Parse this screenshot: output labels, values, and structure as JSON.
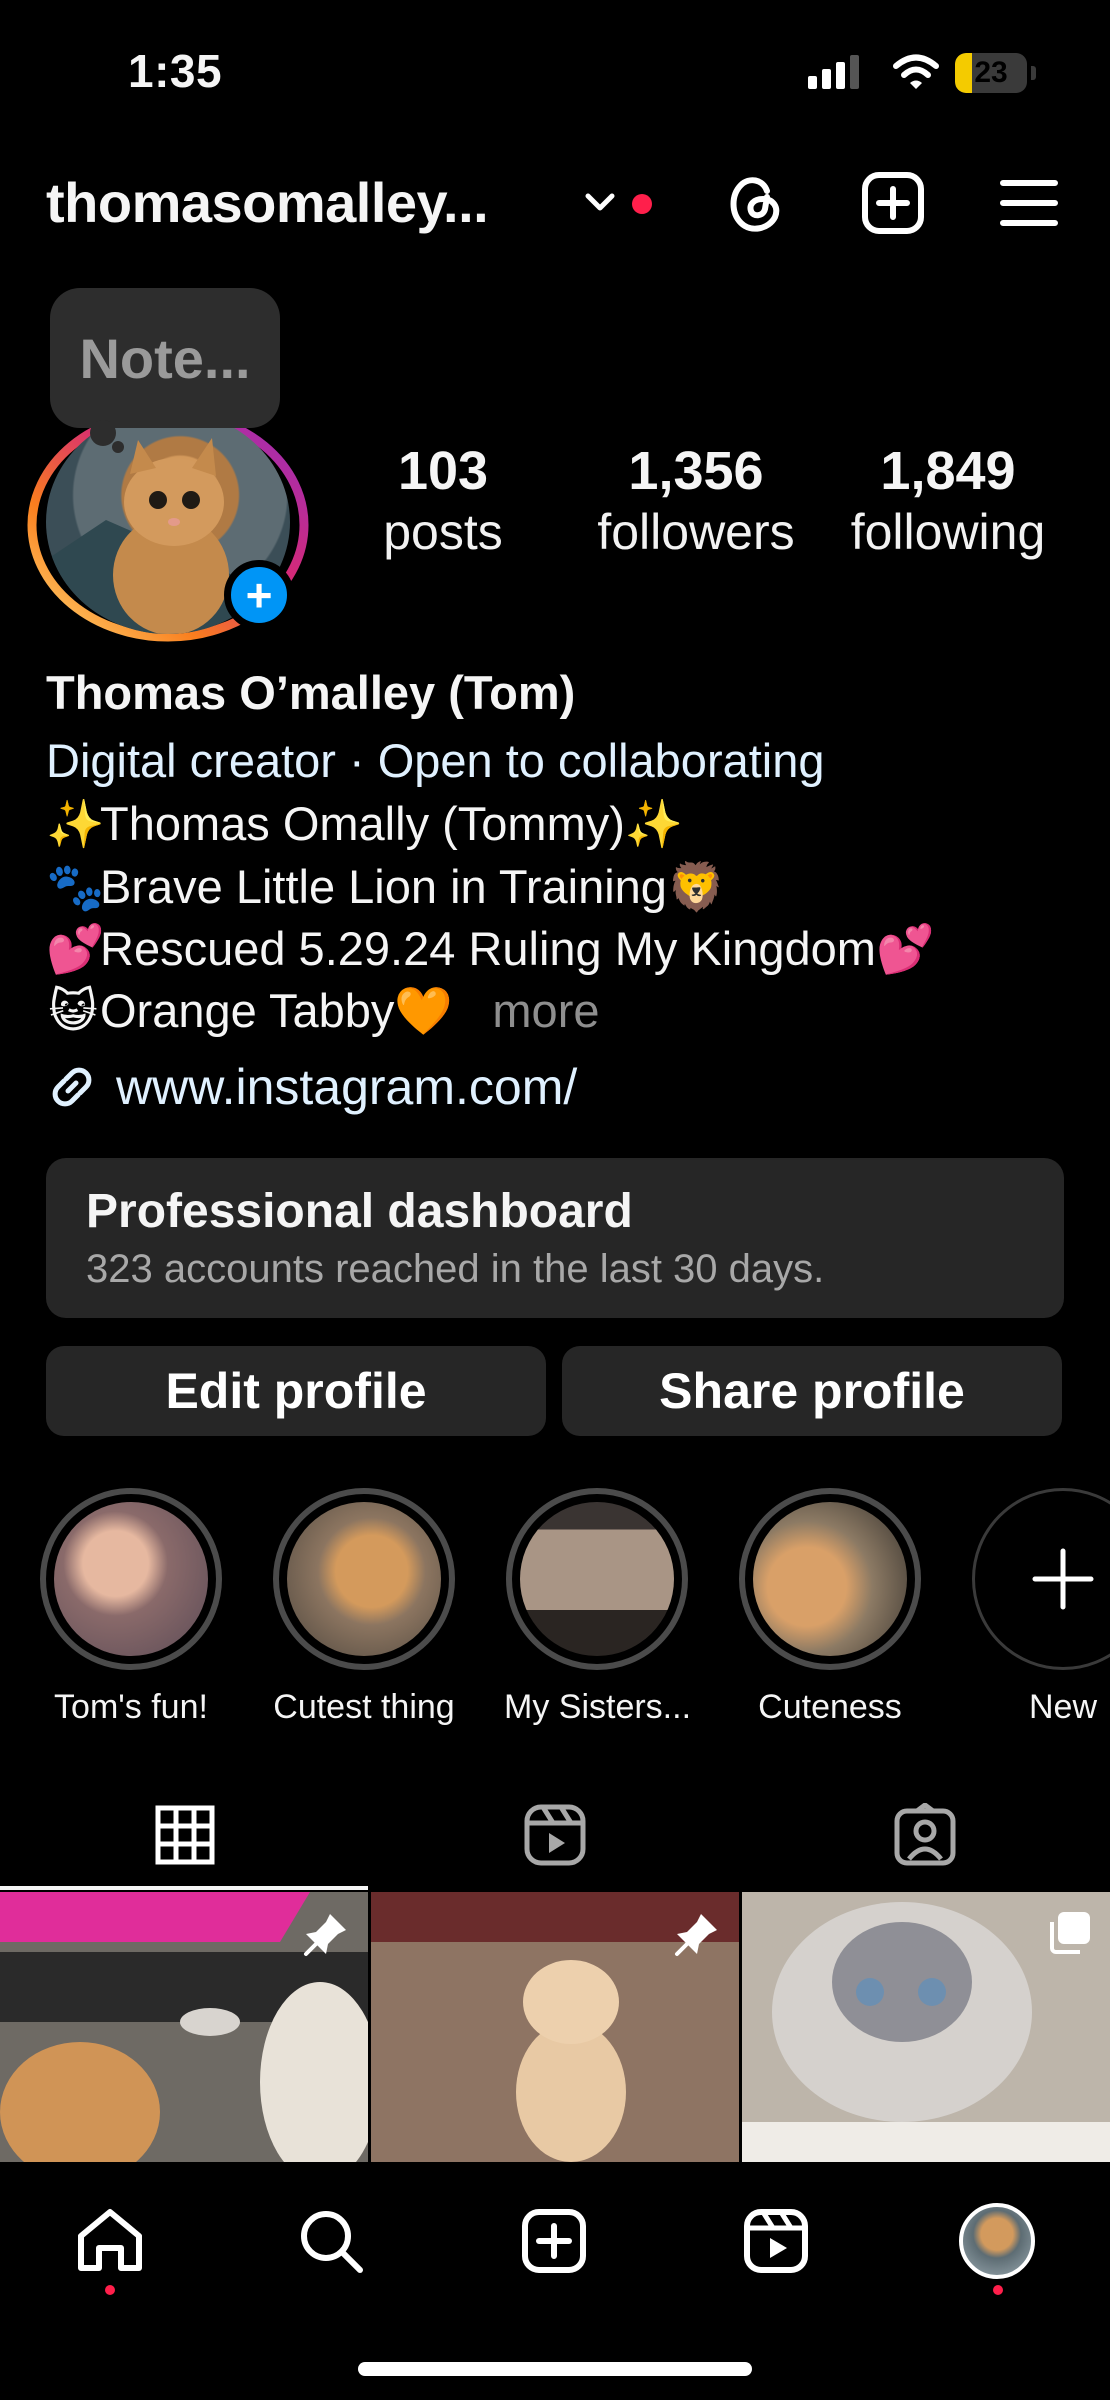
{
  "status_bar": {
    "time": "1:35",
    "battery": "23",
    "battery_level": 0.23,
    "signal_bars": 3
  },
  "header": {
    "username": "thomasomalley...",
    "icons": [
      "chevron-down-icon",
      "threads-icon",
      "create-icon",
      "menu-icon"
    ]
  },
  "note": {
    "placeholder": "Note..."
  },
  "stats": [
    {
      "value": "103",
      "label": "posts"
    },
    {
      "value": "1,356",
      "label": "followers"
    },
    {
      "value": "1,849",
      "label": "following"
    }
  ],
  "bio": {
    "name": "Thomas O’malley (Tom)",
    "category": "Digital creator · Open to collaborating",
    "lines": [
      {
        "emoji_start": "✨",
        "text": "Thomas Omally (Tommy)",
        "emoji_end": "✨"
      },
      {
        "emoji_start": "🐾",
        "text": "Brave Little Lion in Training",
        "emoji_end": "🦁"
      },
      {
        "emoji_start": "💕",
        "text": "Rescued 5.29.24 Ruling My Kingdom",
        "emoji_end": "💕"
      },
      {
        "emoji_start": "😺",
        "text": "Orange Tabby",
        "emoji_end": "🧡"
      }
    ],
    "more": "more",
    "link": "www.instagram.com/"
  },
  "dashboard": {
    "title": "Professional dashboard",
    "subtitle": "323 accounts reached in the last 30 days."
  },
  "buttons": {
    "edit": "Edit profile",
    "share": "Share profile"
  },
  "highlights": [
    {
      "label": "Tom's fun!"
    },
    {
      "label": "Cutest thing"
    },
    {
      "label": "My Sisters..."
    },
    {
      "label": "Cuteness"
    },
    {
      "label": "New"
    }
  ],
  "tabs": [
    "grid-icon",
    "reels-icon",
    "tagged-icon"
  ],
  "posts": [
    {
      "name": "post-kittens-pinned",
      "badge": "pin-icon"
    },
    {
      "name": "post-kitten-floor-pinned",
      "badge": "pin-icon"
    },
    {
      "name": "post-siamese-cat",
      "badge": "carousel-icon"
    }
  ],
  "nav": [
    "home-icon",
    "search-icon",
    "create-icon",
    "reels-icon",
    "profile-avatar"
  ],
  "colors": {
    "background": "#000000",
    "accent_blue": "#0095f6",
    "notification_red": "#ff1f4b",
    "link": "#e0f1ff",
    "battery": "#f4cb00"
  }
}
